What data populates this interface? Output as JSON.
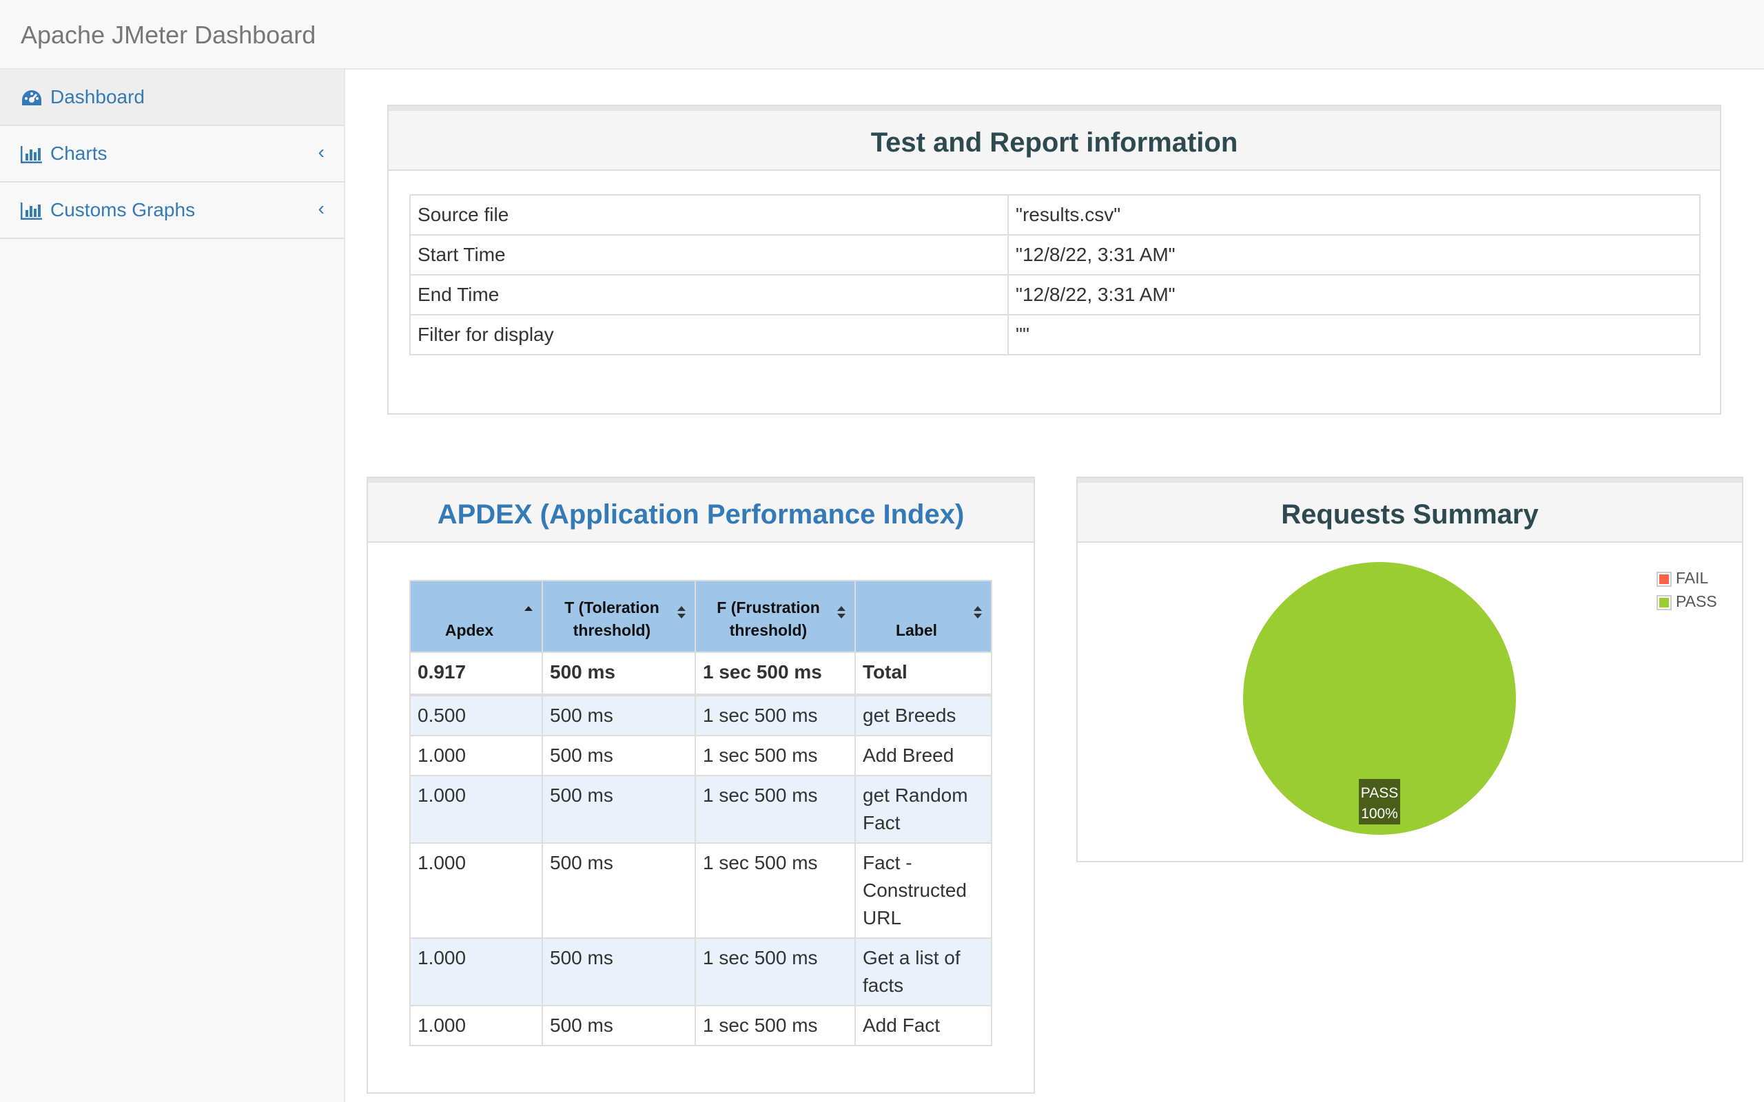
{
  "app": {
    "title": "Apache JMeter Dashboard"
  },
  "sidebar": {
    "items": [
      {
        "label": "Dashboard",
        "icon": "dashboard-icon",
        "active": true
      },
      {
        "label": "Charts",
        "icon": "bar-chart-icon",
        "expand_icon": "chevron-left-icon"
      },
      {
        "label": "Customs Graphs",
        "icon": "bar-chart-icon",
        "expand_icon": "chevron-left-icon"
      }
    ]
  },
  "info": {
    "title": "Test and Report information",
    "rows": [
      {
        "key": "Source file",
        "value": "\"results.csv\""
      },
      {
        "key": "Start Time",
        "value": "\"12/8/22, 3:31 AM\""
      },
      {
        "key": "End Time",
        "value": "\"12/8/22, 3:31 AM\""
      },
      {
        "key": "Filter for display",
        "value": "\"\""
      }
    ]
  },
  "apdex": {
    "title": "APDEX (Application Performance Index)",
    "headers": [
      "Apdex",
      "T (Toleration threshold)",
      "F (Frustration threshold)",
      "Label"
    ],
    "header_lines": [
      [
        "Apdex"
      ],
      [
        "T (Toleration",
        "threshold)"
      ],
      [
        "F (Frustration",
        "threshold)"
      ],
      [
        "Label"
      ]
    ],
    "total": [
      "0.917",
      "500 ms",
      "1 sec 500 ms",
      "Total"
    ],
    "rows": [
      [
        "0.500",
        "500 ms",
        "1 sec 500 ms",
        "get Breeds"
      ],
      [
        "1.000",
        "500 ms",
        "1 sec 500 ms",
        "Add Breed"
      ],
      [
        "1.000",
        "500 ms",
        "1 sec 500 ms",
        "get Random Fact"
      ],
      [
        "1.000",
        "500 ms",
        "1 sec 500 ms",
        "Fact - Constructed URL"
      ],
      [
        "1.000",
        "500 ms",
        "1 sec 500 ms",
        "Get a list of facts"
      ],
      [
        "1.000",
        "500 ms",
        "1 sec 500 ms",
        "Add Fact"
      ]
    ],
    "colors": {
      "header": "#9fc5e8",
      "stripe": "#eaf1fa"
    }
  },
  "requests_summary": {
    "title": "Requests Summary",
    "legend": [
      {
        "label": "FAIL",
        "color": "#ff6347"
      },
      {
        "label": "PASS",
        "color": "#9acd32"
      }
    ],
    "slice_label": {
      "name": "PASS",
      "percent": "100%"
    }
  },
  "chart_data": {
    "type": "pie",
    "title": "Requests Summary",
    "categories": [
      "FAIL",
      "PASS"
    ],
    "values": [
      0,
      100
    ],
    "colors": [
      "#ff6347",
      "#9acd32"
    ],
    "legend_position": "top-right"
  }
}
